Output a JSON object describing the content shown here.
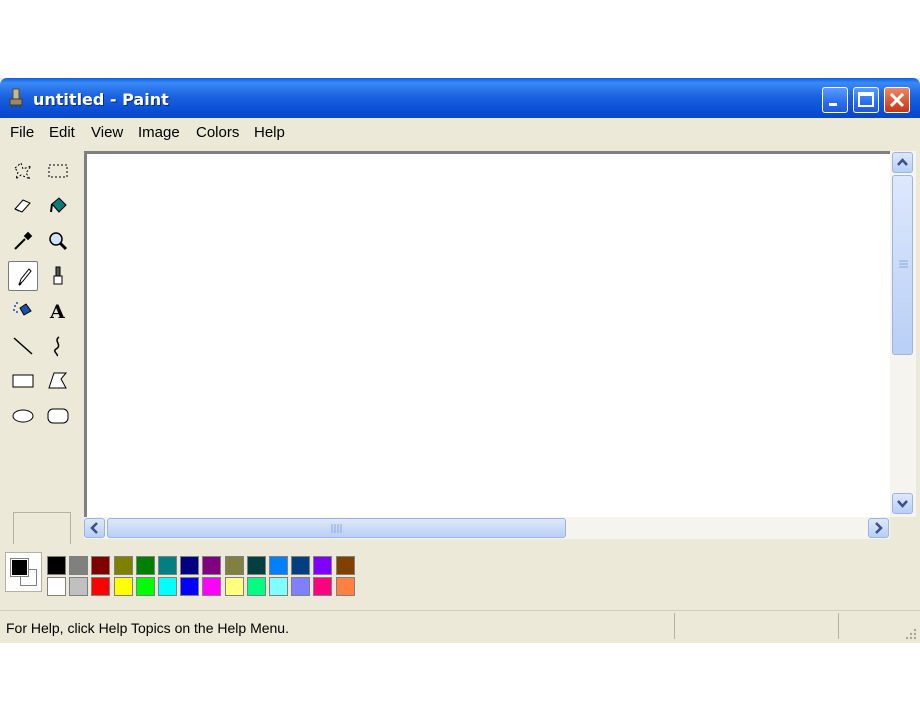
{
  "window": {
    "title": "untitled - Paint"
  },
  "menu": [
    "File",
    "Edit",
    "View",
    "Image",
    "Colors",
    "Help"
  ],
  "tools": [
    {
      "name": "free-form-select-icon"
    },
    {
      "name": "rectangle-select-icon"
    },
    {
      "name": "eraser-icon"
    },
    {
      "name": "fill-bucket-icon"
    },
    {
      "name": "color-picker-icon"
    },
    {
      "name": "magnifier-icon"
    },
    {
      "name": "pencil-icon",
      "selected": true
    },
    {
      "name": "brush-icon"
    },
    {
      "name": "airbrush-icon"
    },
    {
      "name": "text-icon",
      "glyph": "A"
    },
    {
      "name": "line-icon"
    },
    {
      "name": "curve-icon"
    },
    {
      "name": "rectangle-icon"
    },
    {
      "name": "polygon-icon"
    },
    {
      "name": "ellipse-icon"
    },
    {
      "name": "rounded-rectangle-icon"
    }
  ],
  "palette": {
    "foreground": "#000000",
    "background": "#ffffff",
    "row1": [
      "#000000",
      "#808080",
      "#800000",
      "#808000",
      "#008000",
      "#008080",
      "#000080",
      "#800080",
      "#808040",
      "#004040",
      "#0080ff",
      "#004080",
      "#8000ff",
      "#804000"
    ],
    "row2": [
      "#ffffff",
      "#c0c0c0",
      "#ff0000",
      "#ffff00",
      "#00ff00",
      "#00ffff",
      "#0000ff",
      "#ff00ff",
      "#ffff80",
      "#00ff80",
      "#80ffff",
      "#8080ff",
      "#ff0080",
      "#ff8040"
    ]
  },
  "status": {
    "help_text": "For Help, click Help Topics on the Help Menu."
  }
}
